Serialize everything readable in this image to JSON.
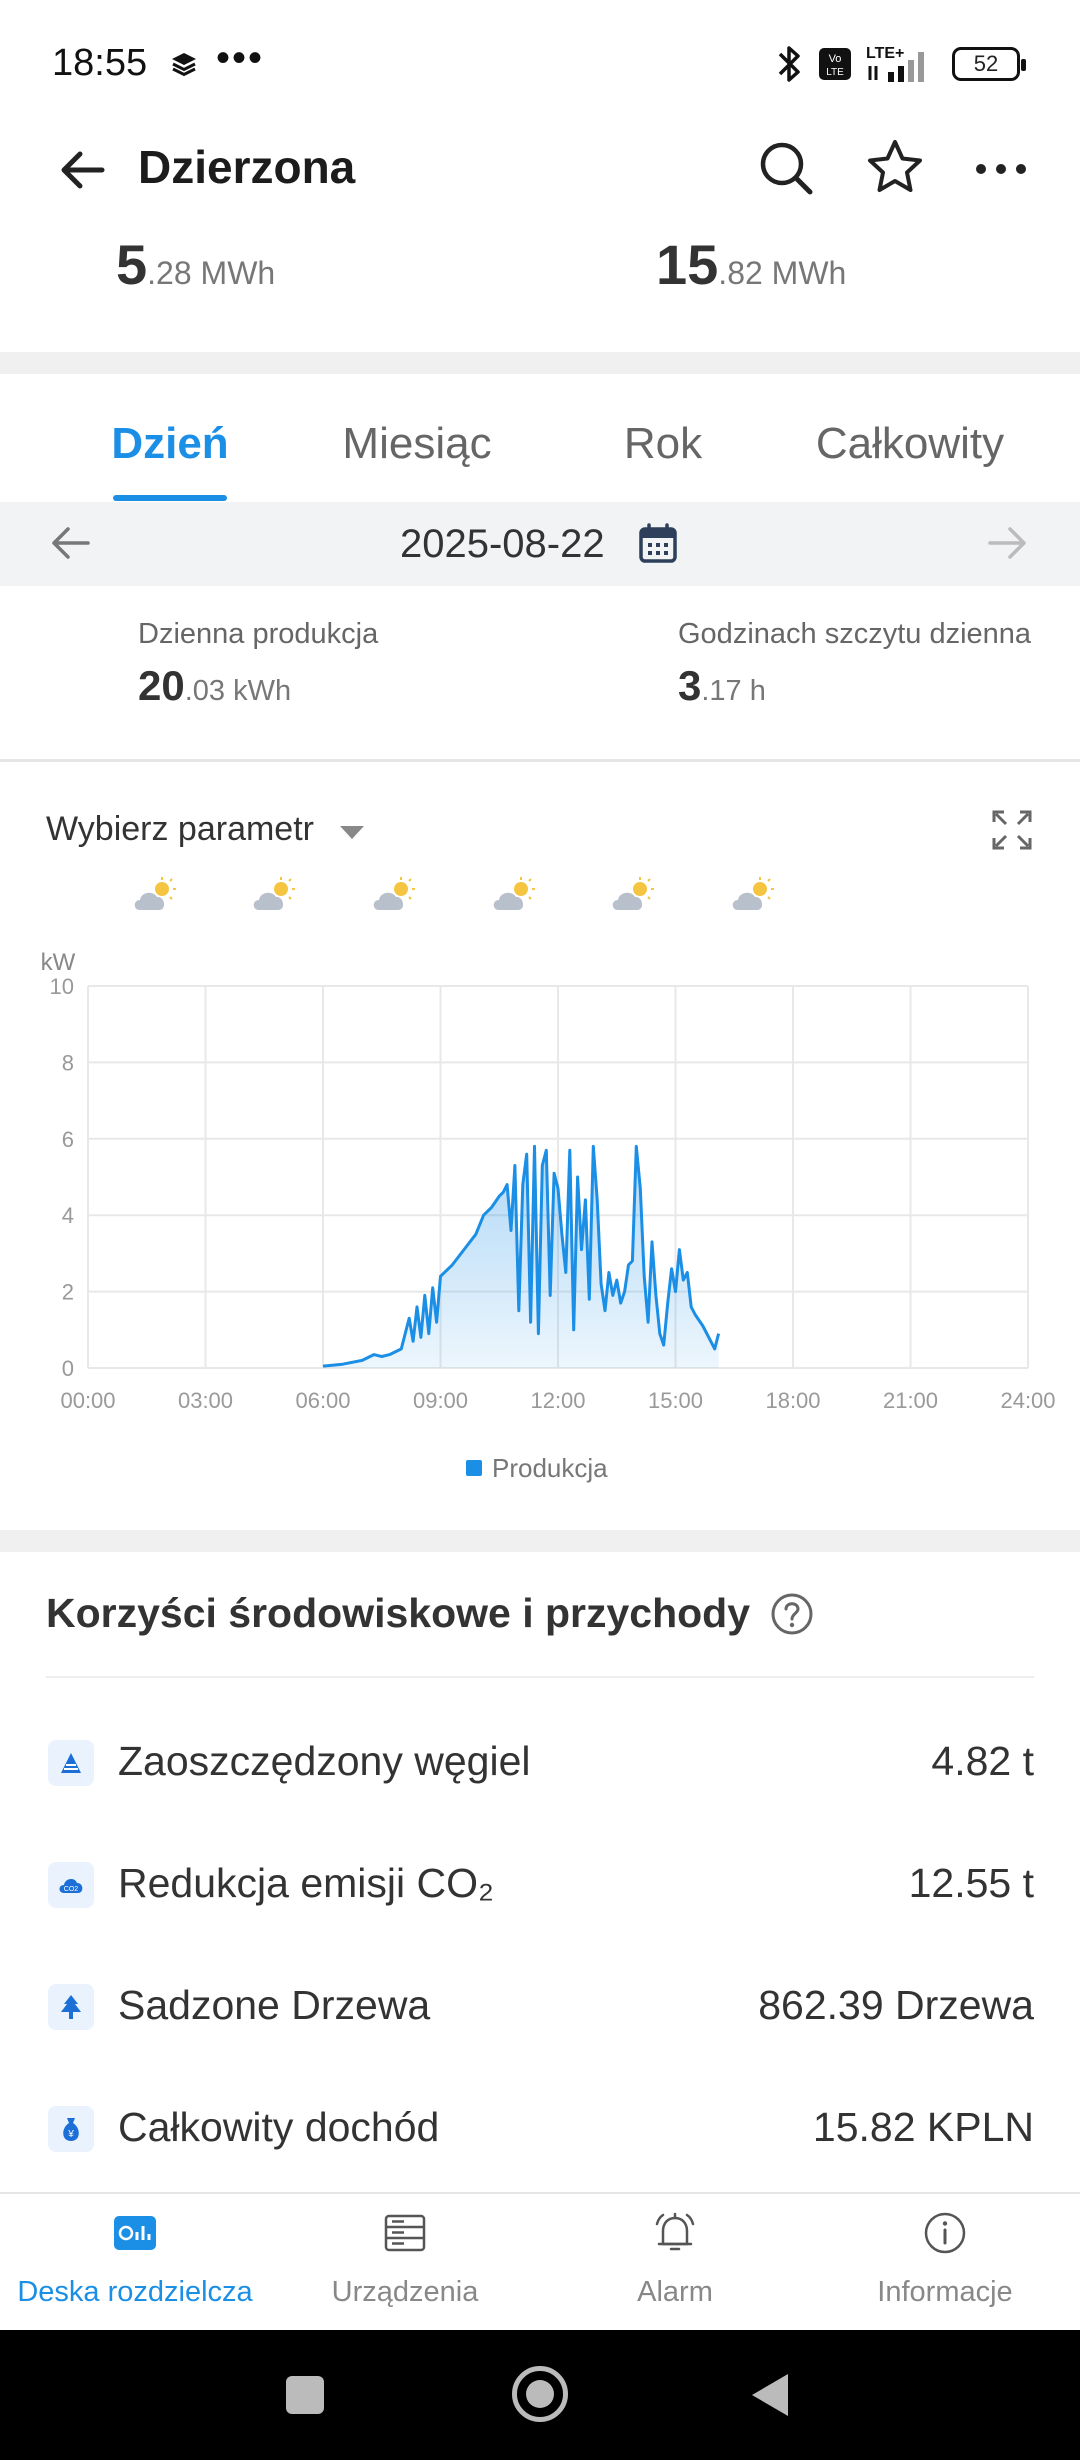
{
  "status_bar": {
    "time": "18:55",
    "dots": "•••",
    "battery": "52",
    "network": "LTE+"
  },
  "header": {
    "title": "Dzierzona"
  },
  "totals": {
    "total_energy_int": "5",
    "total_energy_dec": ".28 MWh",
    "total_income_int": "15",
    "total_income_dec": ".82 MWh"
  },
  "tabs": [
    {
      "label": "Dzień",
      "active": true
    },
    {
      "label": "Miesiąc",
      "active": false
    },
    {
      "label": "Rok",
      "active": false
    },
    {
      "label": "Całkowity",
      "active": false
    }
  ],
  "date_nav": {
    "date": "2025-08-22"
  },
  "daily_stats": {
    "production_label": "Dzienna produkcja",
    "production_int": "20",
    "production_dec": ".03 kWh",
    "peak_label": "Godzinach szczytu dzienna",
    "peak_int": "3",
    "peak_dec": ".17 h"
  },
  "chart_section": {
    "param_label": "Wybierz parametr",
    "weather": [
      "partly-cloudy-icon",
      "partly-cloudy-icon",
      "partly-cloudy-icon",
      "partly-cloudy-icon",
      "partly-cloudy-icon",
      "partly-cloudy-icon"
    ]
  },
  "chart_data": {
    "type": "area",
    "ylabel": "kW",
    "ylim": [
      0,
      10
    ],
    "yticks": [
      0,
      2,
      4,
      6,
      8,
      10
    ],
    "xticks": [
      "00:00",
      "03:00",
      "06:00",
      "09:00",
      "12:00",
      "15:00",
      "18:00",
      "21:00",
      "24:00"
    ],
    "xlim": [
      0,
      24
    ],
    "grid": true,
    "legend_position": "bottom",
    "color": "#1b8ee6",
    "series": [
      {
        "name": "Produkcja",
        "x": [
          6.0,
          6.5,
          7.0,
          7.3,
          7.5,
          7.7,
          8.0,
          8.1,
          8.2,
          8.3,
          8.4,
          8.5,
          8.6,
          8.7,
          8.8,
          8.9,
          9.0,
          9.3,
          9.6,
          9.9,
          10.1,
          10.3,
          10.5,
          10.6,
          10.7,
          10.8,
          10.9,
          11.0,
          11.1,
          11.2,
          11.3,
          11.4,
          11.5,
          11.6,
          11.7,
          11.8,
          11.9,
          12.0,
          12.1,
          12.2,
          12.3,
          12.4,
          12.5,
          12.6,
          12.7,
          12.8,
          12.9,
          13.0,
          13.1,
          13.2,
          13.3,
          13.4,
          13.5,
          13.6,
          13.7,
          13.8,
          13.9,
          14.0,
          14.1,
          14.2,
          14.3,
          14.4,
          14.5,
          14.6,
          14.7,
          14.8,
          14.9,
          15.0,
          15.1,
          15.2,
          15.3,
          15.4,
          15.5,
          15.7,
          15.9,
          16.0,
          16.1
        ],
        "values": [
          0.05,
          0.1,
          0.2,
          0.35,
          0.3,
          0.35,
          0.5,
          0.9,
          1.3,
          0.7,
          1.6,
          0.8,
          1.9,
          0.9,
          2.1,
          1.2,
          2.4,
          2.7,
          3.1,
          3.5,
          4.0,
          4.2,
          4.5,
          4.6,
          4.8,
          3.6,
          5.3,
          1.5,
          4.8,
          5.6,
          1.2,
          5.8,
          0.9,
          5.3,
          5.7,
          1.9,
          5.1,
          4.7,
          3.5,
          2.5,
          5.7,
          1.0,
          5.0,
          3.1,
          4.4,
          1.8,
          5.8,
          4.4,
          2.2,
          1.5,
          2.5,
          1.9,
          2.3,
          1.7,
          2.0,
          2.7,
          2.8,
          5.8,
          4.7,
          2.4,
          1.2,
          3.3,
          1.9,
          0.9,
          0.6,
          1.7,
          2.6,
          2.0,
          3.1,
          2.3,
          2.5,
          1.6,
          1.4,
          1.1,
          0.7,
          0.5,
          0.9
        ]
      }
    ]
  },
  "benefits": {
    "title": "Korzyści środowiskowe i przychody",
    "items": [
      {
        "icon": "coal-icon",
        "label": "Zaoszczędzony węgiel",
        "value": "4.82 t"
      },
      {
        "icon": "co2-cloud-icon",
        "label": "Redukcja emisji CO₂",
        "value": "12.55 t"
      },
      {
        "icon": "tree-icon",
        "label": "Sadzone Drzewa",
        "value": "862.39 Drzewa"
      },
      {
        "icon": "money-bag-icon",
        "label": "Całkowity dochód",
        "value": "15.82 KPLN"
      }
    ]
  },
  "bottom_nav": [
    {
      "icon": "dashboard-icon",
      "label": "Deska rozdzielcza",
      "active": true
    },
    {
      "icon": "devices-icon",
      "label": "Urządzenia",
      "active": false
    },
    {
      "icon": "alarm-bell-icon",
      "label": "Alarm",
      "active": false
    },
    {
      "icon": "info-icon",
      "label": "Informacje",
      "active": false
    }
  ]
}
